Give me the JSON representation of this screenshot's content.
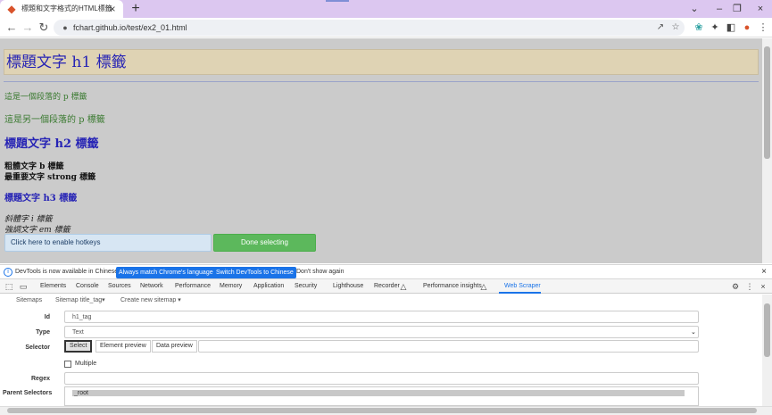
{
  "browser": {
    "tab_title": "標題和文字格式的HTML標籤",
    "tab_icon": "html5-icon",
    "url": "fchart.github.io/test/ex2_01.html"
  },
  "page": {
    "h1": "標題文字 h1 標籤",
    "p1": "這是一個段落的 p 標籤",
    "p2": "這是另一個段落的 p 標籤",
    "h2": "標題文字 h2 標籤",
    "b": "粗體文字 b 標籤",
    "strong": "最重要文字 strong 標籤",
    "h3": "標題文字 h3 標籤",
    "i": "斜體字 i 標籤",
    "em": "強調文字 em 標籤"
  },
  "scraper_bar": {
    "hotkeys": "Click here to enable hotkeys",
    "done": "Done selecting"
  },
  "devtools": {
    "info": {
      "message": "DevTools is now available in Chinese!",
      "btn_match": "Always match Chrome's language",
      "btn_switch": "Switch DevTools to Chinese",
      "dont_show": "Don't show again"
    },
    "tabs": [
      "Elements",
      "Console",
      "Sources",
      "Network",
      "Performance",
      "Memory",
      "Application",
      "Security",
      "Lighthouse",
      "Recorder",
      "Performance insights",
      "Web Scraper"
    ],
    "active_tab": "Web Scraper",
    "subnav": {
      "sitemaps": "Sitemaps",
      "sitemap": "Sitemap title_tag",
      "create": "Create new sitemap"
    },
    "form": {
      "id_label": "Id",
      "id_value": "h1_tag",
      "type_label": "Type",
      "type_value": "Text",
      "selector_label": "Selector",
      "select_btn": "Select",
      "element_preview_btn": "Element preview",
      "data_preview_btn": "Data preview",
      "multiple_label": "Multiple",
      "regex_label": "Regex",
      "parent_label": "Parent Selectors",
      "parent_value": "_root"
    }
  },
  "colors": {
    "heading": "#2623b5",
    "paragraph": "#3a7a30",
    "h1_background": "#dfd3b4",
    "done_button": "#5cb85c",
    "accent": "#1a73e8"
  }
}
